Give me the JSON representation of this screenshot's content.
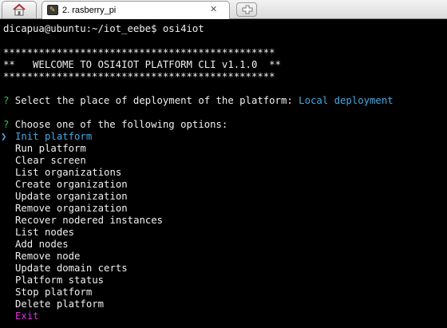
{
  "tabs": {
    "home_icon": "home-icon",
    "session": {
      "icon": "putty-icon",
      "icon_glyph": "✎",
      "label": "2. rasberry_pi",
      "close": "✕"
    },
    "new_tab_icon": "new-tab-icon"
  },
  "terminal": {
    "prompt": "dicapua@ubuntu:~/iot_eebe$ osi4iot",
    "banner": [
      "**********************************************",
      "**   WELCOME TO OSI4IOT PLATFORM CLI v1.1.0  **",
      "**********************************************"
    ],
    "question1": {
      "mark": "?",
      "text": " Select the place of deployment of the platform: ",
      "answer": "Local deployment"
    },
    "question2": {
      "mark": "?",
      "text": " Choose one of the following options:"
    },
    "pointer": "❯",
    "options": [
      "Init platform",
      "Run platform",
      "Clear screen",
      "List organizations",
      "Create organization",
      "Update organization",
      "Remove organization",
      "Recover nodered instances",
      "List nodes",
      "Add nodes",
      "Remove node",
      "Update domain certs",
      "Platform status",
      "Stop platform",
      "Delete platform",
      "Exit"
    ],
    "selected_index": 0
  },
  "colors": {
    "background": "#000000",
    "text": "#f0f0f0",
    "question_mark": "#2ecc40",
    "answer": "#49a7e0",
    "selected": "#49a7e0",
    "exit": "#d633d6"
  }
}
